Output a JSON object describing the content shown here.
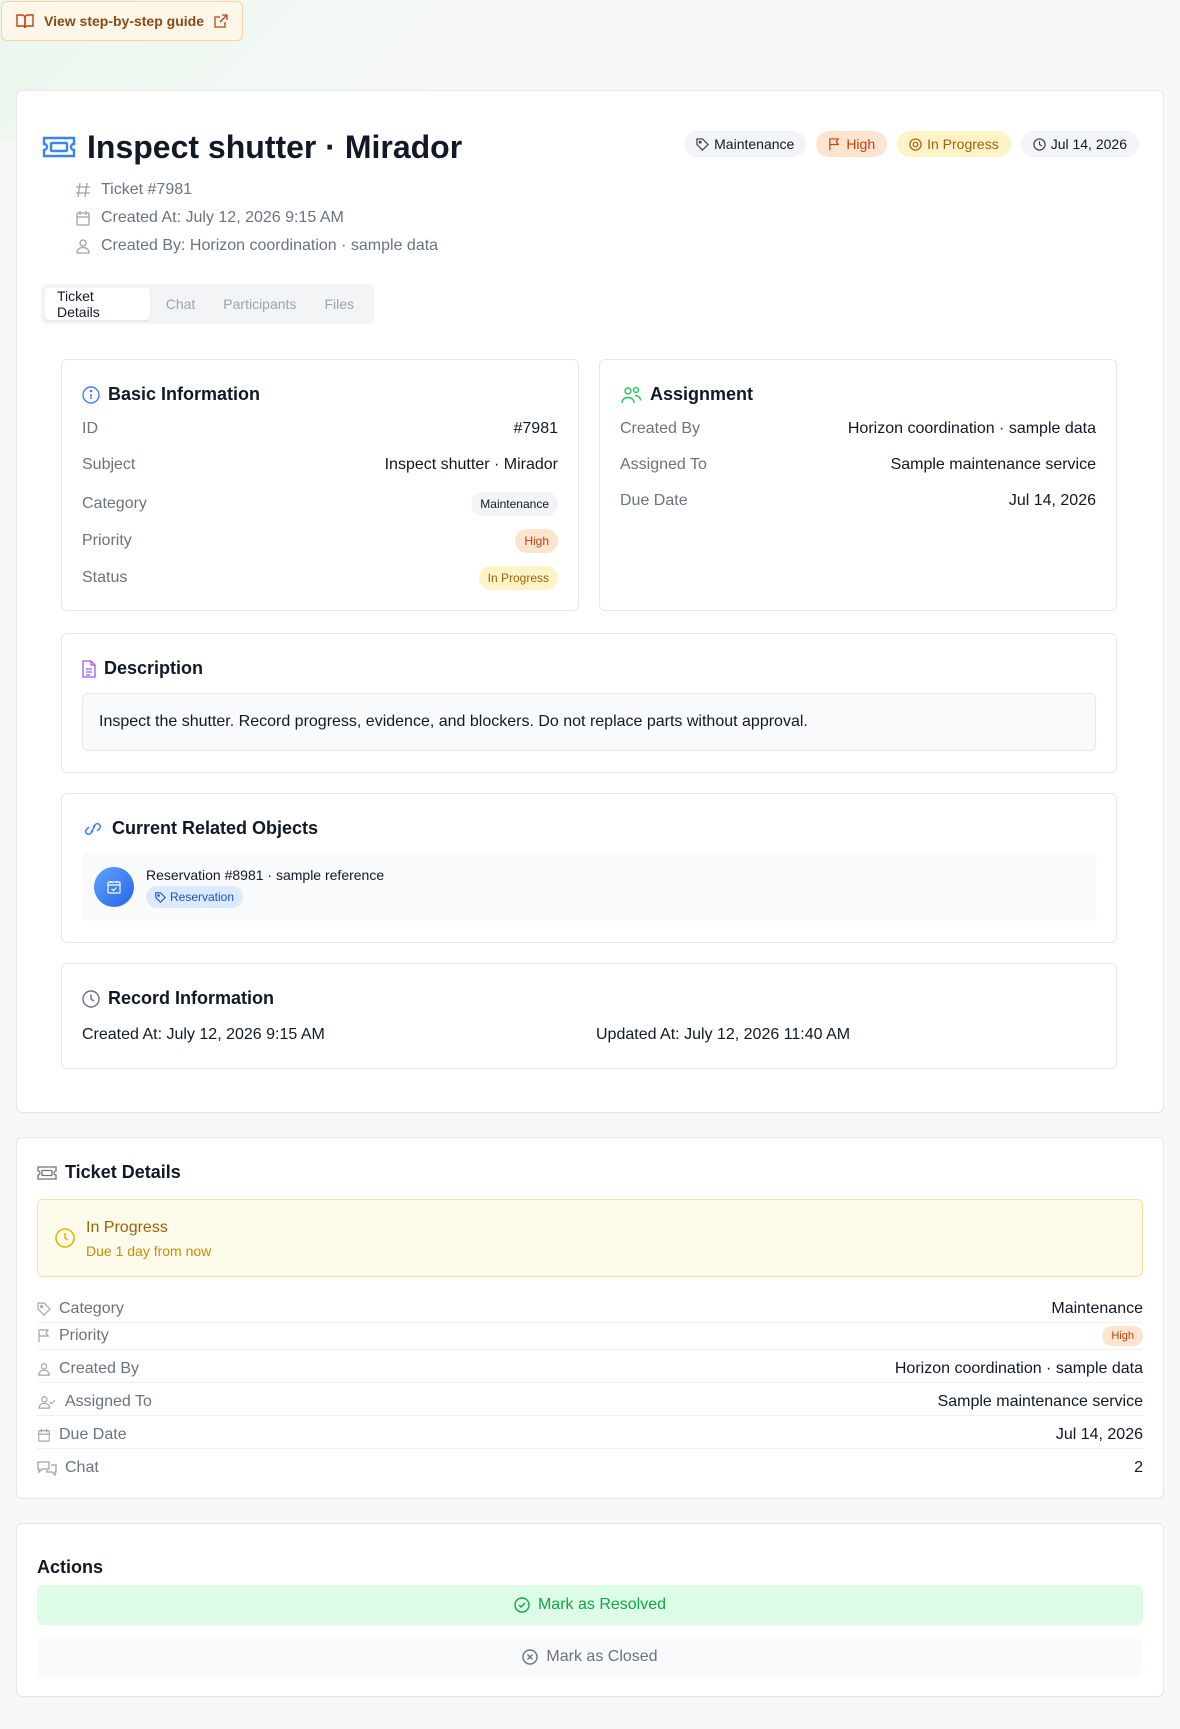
{
  "guide": {
    "label": "View step-by-step guide"
  },
  "ticket": {
    "title": "Inspect shutter · Mirador",
    "badges": {
      "category": "Maintenance",
      "priority": "High",
      "status": "In Progress",
      "due": "Jul 14, 2026"
    },
    "meta": {
      "number": "Ticket #7981",
      "created_at": "Created At: July 12, 2026 9:15 AM",
      "created_by": "Created By: Horizon coordination · sample data"
    },
    "tabs": [
      "Ticket Details",
      "Chat",
      "Participants",
      "Files"
    ]
  },
  "basic": {
    "title": "Basic Information",
    "rows": [
      {
        "label": "ID",
        "value": "#7981"
      },
      {
        "label": "Subject",
        "value": "Inspect shutter · Mirador"
      },
      {
        "label": "Category",
        "value": "Maintenance"
      },
      {
        "label": "Priority",
        "value": "High"
      },
      {
        "label": "Status",
        "value": "In Progress"
      }
    ]
  },
  "assignment": {
    "title": "Assignment",
    "rows": [
      {
        "label": "Created By",
        "value": "Horizon coordination · sample data"
      },
      {
        "label": "Assigned To",
        "value": "Sample maintenance service"
      },
      {
        "label": "Due Date",
        "value": "Jul 14, 2026"
      }
    ]
  },
  "description": {
    "title": "Description",
    "text": "Inspect the shutter. Record progress, evidence, and blockers. Do not replace parts without approval."
  },
  "related": {
    "title": "Current Related Objects",
    "item": {
      "name": "Reservation #8981 · sample reference",
      "tag": "Reservation"
    }
  },
  "record": {
    "title": "Record Information",
    "created": "Created At: July 12, 2026 9:15 AM",
    "updated": "Updated At: July 12, 2026 11:40 AM"
  },
  "details": {
    "title": "Ticket Details",
    "status": "In Progress",
    "due_note": "Due 1 day from now",
    "rows": [
      {
        "label": "Category",
        "value": "Maintenance"
      },
      {
        "label": "Priority",
        "value": "High"
      },
      {
        "label": "Created By",
        "value": "Horizon coordination · sample data"
      },
      {
        "label": "Assigned To",
        "value": "Sample maintenance service"
      },
      {
        "label": "Due Date",
        "value": "Jul 14, 2026"
      },
      {
        "label": "Chat",
        "value": "2"
      }
    ]
  },
  "actions": {
    "title": "Actions",
    "resolve": "Mark as Resolved",
    "close": "Mark as Closed"
  },
  "colors": {
    "accent": "#2563eb",
    "warning": "#a16207",
    "success": "#16a34a",
    "danger": "#c2410c"
  }
}
